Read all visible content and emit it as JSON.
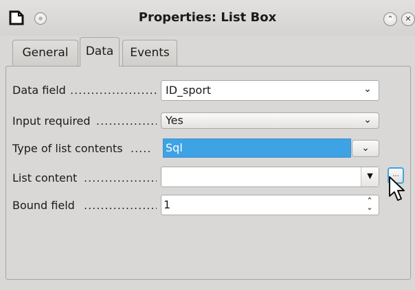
{
  "window": {
    "title": "Properties: List Box",
    "app_icon": "document-corner-icon",
    "minimize_icon": "chevron-up-icon",
    "minimize_glyph": "⌃",
    "close_icon": "close-icon",
    "close_glyph": "✕"
  },
  "tabs": [
    {
      "label": "General",
      "active": false
    },
    {
      "label": "Data",
      "active": true
    },
    {
      "label": "Events",
      "active": false
    }
  ],
  "fields": {
    "data_field": {
      "label": "Data field",
      "dots": "......................",
      "value": "ID_sport",
      "chevron": "⌄"
    },
    "input_required": {
      "label": "Input required",
      "dots": "................",
      "value": "Yes",
      "chevron": "⌄"
    },
    "list_type": {
      "label": "Type of list contents",
      "dots": ".....",
      "value": "Sql",
      "chevron": "⌄"
    },
    "list_content": {
      "label": "List content",
      "dots": "...................",
      "value": "",
      "arrow": "▼",
      "button_label": "..."
    },
    "bound_field": {
      "label": "Bound field",
      "dots": "....................",
      "value": "1",
      "spin_up": "⌃",
      "spin_down": "⌄"
    }
  },
  "colors": {
    "selection": "#3da3e5",
    "focus_border": "#3da3e5",
    "window_bg": "#d9d8d6"
  }
}
